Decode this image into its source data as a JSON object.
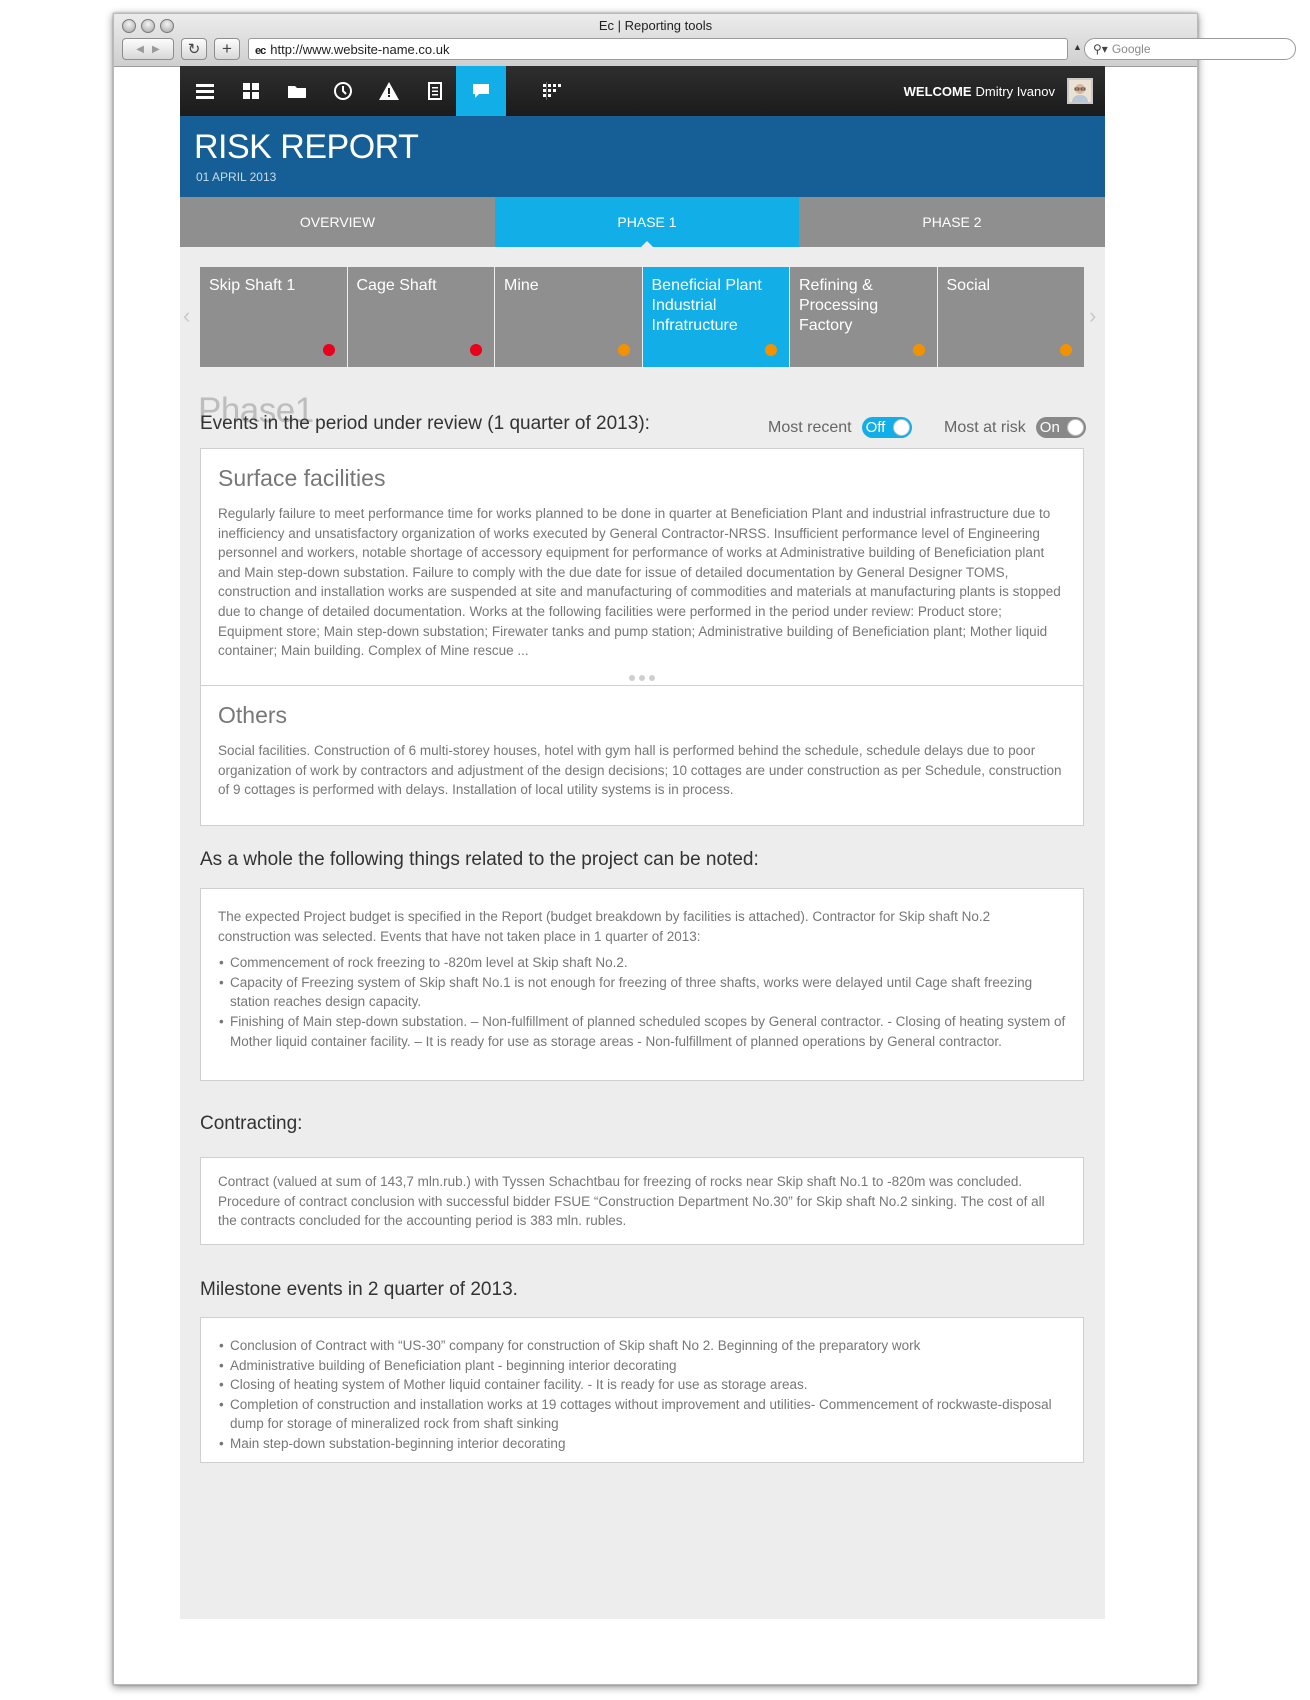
{
  "browser": {
    "window_title": "Ec  |  Reporting tools",
    "url_prefix": "ec",
    "url": "http://www.website-name.co.uk",
    "search_placeholder": "Google"
  },
  "topbar": {
    "icons": [
      "menu-icon",
      "grid-icon",
      "folder-icon",
      "clock-icon",
      "warning-icon",
      "document-icon",
      "chat-icon",
      "apps-icon"
    ],
    "active_icon": "chat-icon",
    "welcome_label": "WELCOME",
    "user_name": "Dmitry Ivanov"
  },
  "header": {
    "title": "RISK REPORT",
    "date": "01 APRIL 2013"
  },
  "phase_tabs": [
    {
      "label": "OVERVIEW",
      "active": false
    },
    {
      "label": "PHASE 1",
      "active": true
    },
    {
      "label": "PHASE 2",
      "active": false
    }
  ],
  "facilities": [
    {
      "label": "Skip Shaft 1",
      "status_color": "#e8001c",
      "active": false
    },
    {
      "label": "Cage Shaft",
      "status_color": "#e8001c",
      "active": false
    },
    {
      "label": "Mine",
      "status_color": "#f39200",
      "active": false
    },
    {
      "label": "Beneficial Plant Industrial Infratructure",
      "status_color": "#f39200",
      "active": true
    },
    {
      "label": "Refining & Processing Factory",
      "status_color": "#f39200",
      "active": false
    },
    {
      "label": "Social",
      "status_color": "#f39200",
      "active": false
    }
  ],
  "phase_heading": "Phase1",
  "toggles": {
    "most_recent": {
      "label": "Most recent",
      "state": "Off"
    },
    "most_at_risk": {
      "label": "Most at risk",
      "state": "On"
    }
  },
  "events": {
    "title": "Events in the period under review (1 quarter of 2013):",
    "surface": {
      "title": "Surface facilities",
      "text": "Regularly failure to meet performance time for works planned to be done in quarter at Beneficiation Plant and industrial infrastructure due to inefficiency and unsatisfactory organization of works executed by General Contractor-NRSS. Insufficient performance level of Engineering personnel and workers, notable shortage of accessory equipment for performance of works at Administrative building of Beneficiation plant and Main step-down substation. Failure to comply with the due date for issue of detailed documentation by General Designer TOMS, construction and installation works are suspended at site and manufacturing of commodities and materials at manufacturing plants is stopped due to change of detailed documentation. Works at the following facilities were performed in the period under review: Product store; Equipment store; Main step-down substation; Firewater tanks and pump station; Administrative building of Beneficiation plant; Mother liquid container; Main building. Complex of Mine rescue ..."
    },
    "others": {
      "title": "Others",
      "text": "Social facilities. Construction of 6 multi-storey houses, hotel with gym hall is performed behind the schedule, schedule delays due to poor organization of work by contractors and adjustment of the design decisions; 10 cottages are under construction as per Schedule, construction of 9 cottages is performed with delays. Installation of local utility systems is in process."
    }
  },
  "whole": {
    "title": "As a whole the following things related to the project can be noted:",
    "intro": "The expected Project budget is specified in the Report (budget breakdown by facilities is attached). Contractor for Skip shaft No.2 construction was selected. Events that have not taken place in 1 quarter of 2013:",
    "items": [
      "Commencement of rock freezing to -820m level at Skip shaft No.2.",
      "Capacity of Freezing system of Skip shaft No.1 is not enough for freezing of three shafts, works were delayed until Cage shaft freezing station reaches design capacity.",
      "Finishing of Main step-down substation. – Non-fulfillment of planned scheduled scopes by General contractor. - Closing of heating system of Mother liquid container facility. – It is ready for use as storage areas - Non-fulfillment of planned operations by General contractor."
    ]
  },
  "contracting": {
    "title": "Contracting:",
    "text": "Contract (valued at sum of 143,7 mln.rub.) with Tyssen Schachtbau for freezing of rocks near Skip shaft No.1 to -820m was concluded. Procedure of contract conclusion with successful bidder FSUE “Construction Department No.30” for Skip shaft No.2 sinking. The cost of all the contracts concluded for the accounting period is 383 mln. rubles."
  },
  "milestones": {
    "title": "Milestone events in 2 quarter of 2013.",
    "items": [
      "Conclusion of Contract with “US-30” company for construction of Skip shaft No 2. Beginning of the preparatory work",
      "Administrative building of Beneficiation plant - beginning interior decorating",
      "Closing of heating system of Mother liquid container facility. - It is ready for use as storage areas.",
      "Completion of construction and installation works at 19 cottages without improvement and utilities- Commencement of rockwaste-disposal dump for storage of mineralized rock from shaft sinking",
      "Main step-down substation-beginning interior decorating"
    ]
  }
}
